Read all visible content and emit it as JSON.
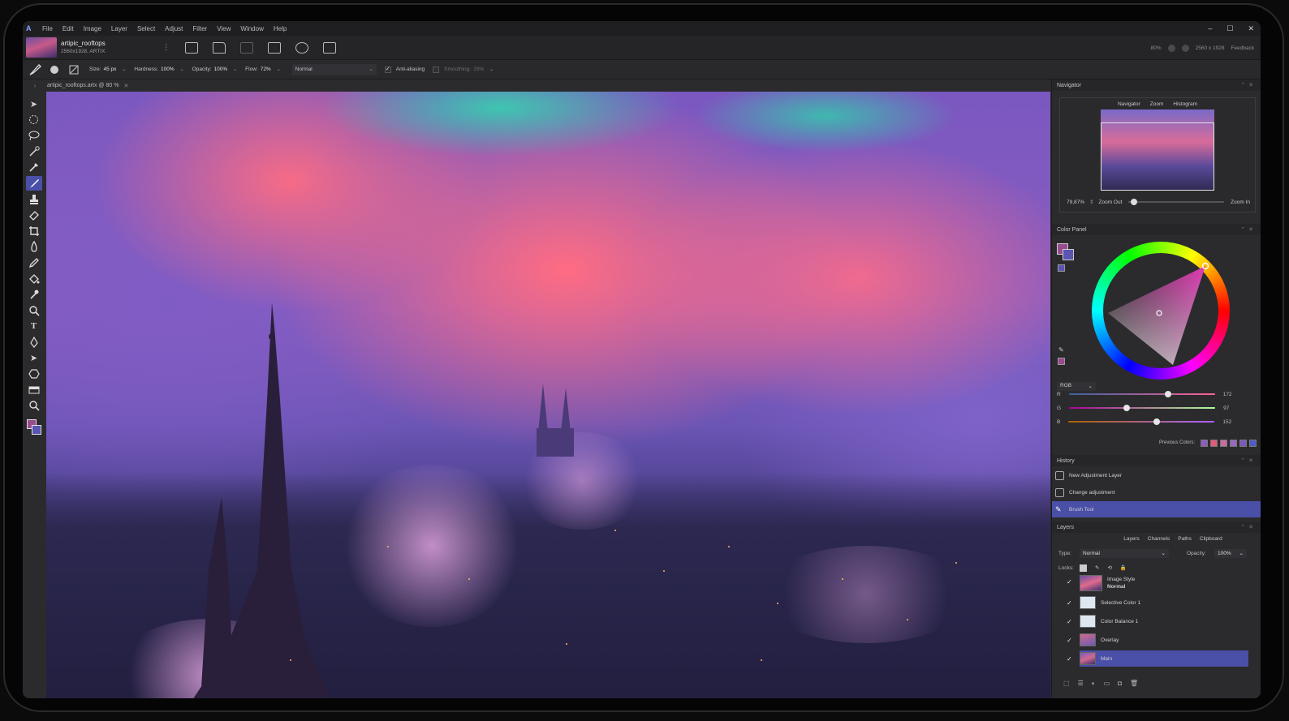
{
  "menubar": {
    "logo": "A",
    "items": [
      "File",
      "Edit",
      "Image",
      "Layer",
      "Select",
      "Adjust",
      "Filter",
      "View",
      "Window",
      "Help"
    ],
    "window_controls": [
      "–",
      "☐",
      "✕"
    ]
  },
  "document": {
    "name": "artipic_rooftops",
    "size": "2560x1928, ARTIX",
    "zoom_display": "80%",
    "dimensions_display": "2560 x 1928",
    "feedback": "Feedback"
  },
  "tool_options": {
    "size_label": "Size:",
    "size_value": "45 px",
    "hardness_label": "Hardness:",
    "hardness_value": "100%",
    "opacity_label": "Opacity:",
    "opacity_value": "100%",
    "flow_label": "Flow:",
    "flow_value": "72%",
    "blend_mode": "Normal",
    "antialias_label": "Anti-aliasing",
    "smoothing_label": "Smoothing:",
    "smoothing_value": "15%"
  },
  "tab": {
    "title": "artipic_rooftops.artx @ 80 %",
    "close": "✕"
  },
  "tools": [
    "select-arrow",
    "marquee",
    "lasso",
    "quick-select",
    "eyedropper",
    "brush",
    "stamp",
    "eraser",
    "crop",
    "blur",
    "pencil",
    "fill",
    "smudge",
    "zoom-lens",
    "text",
    "pen",
    "direct-select",
    "shape",
    "gradient",
    "magnifier"
  ],
  "navigator": {
    "title": "Navigator",
    "tabs": [
      "Navigator",
      "Zoom",
      "Histogram"
    ],
    "zoom_value": "79,87%",
    "zoom_out": "Zoom Out",
    "zoom_in": "Zoom In",
    "slider_fraction": 0.02
  },
  "color_panel": {
    "title": "Color Panel",
    "mode": "RGB",
    "r_label": "R",
    "r_value": "172",
    "g_label": "G",
    "g_value": "97",
    "b_label": "B",
    "b_value": "152",
    "previous_colors_label": "Previous Colors:",
    "previous_colors": [
      "#8e5cc0",
      "#e25a78",
      "#c86ca2",
      "#9a68c0",
      "#7c58b8",
      "#4a5ec4"
    ],
    "accent": "#4a4fa8"
  },
  "history": {
    "title": "History",
    "items": [
      "New Adjustment Layer",
      "Change adjustment",
      "Brush Tool"
    ]
  },
  "layers": {
    "title": "Layers",
    "tabs": [
      "Layers",
      "Channels",
      "Paths",
      "Clipboard"
    ],
    "type_label": "Type:",
    "type_value": "Normal",
    "opacity_label": "Opacity:",
    "opacity_value": "100%",
    "locks_label": "Locks:",
    "items": [
      {
        "name": "Image Style",
        "sub": "Normal"
      },
      {
        "name": "Selective Color  1"
      },
      {
        "name": "Color Balance  1"
      },
      {
        "name": "Overlay"
      },
      {
        "name": "Main"
      }
    ]
  }
}
